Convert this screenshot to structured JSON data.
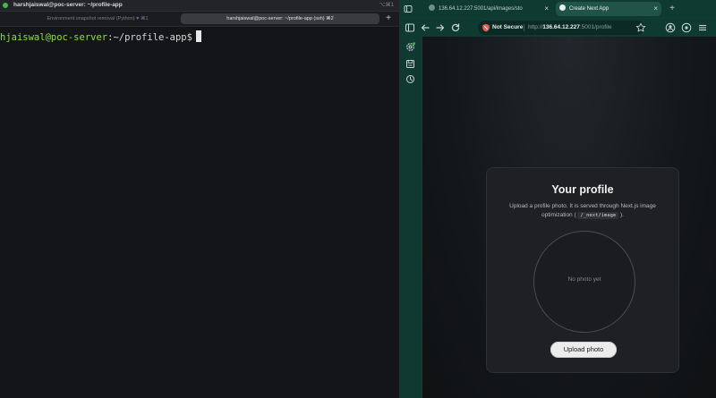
{
  "terminal": {
    "window_title": "harshjaiswal@poc-server: ~/profile-app",
    "shortcut": "⌥⌘1",
    "tabs": [
      {
        "label": "Environment snapshot removal (Python)",
        "count": "⌘1"
      },
      {
        "label": "harshjaiswal@poc-server: ~/profile-app (ssh)",
        "count": "⌘2"
      }
    ],
    "new_tab_label": "+",
    "prompt": {
      "user_host": "hjaiswal@poc-server",
      "separator": ":",
      "path": "~/profile-app",
      "symbol": "$"
    }
  },
  "browser": {
    "tabs": [
      {
        "label": "136.64.12.227:5001/api/images/sto",
        "active": false
      },
      {
        "label": "Create Next App",
        "active": true
      }
    ],
    "new_tab_label": "+",
    "urlbar": {
      "security_label": "Not Secure",
      "scheme": "http://",
      "host": "136.64.12.227",
      "rest": ":5001/profile"
    },
    "page": {
      "title": "Your profile",
      "description_before": "Upload a profile photo. It is served through Next.js image optimization (",
      "code": "/_next/image",
      "description_after": ").",
      "empty_photo_text": "No photo yet",
      "upload_button": "Upload photo"
    }
  },
  "colors": {
    "prompt_user": "#8ae234",
    "terminal_bg": "#141518",
    "browser_chrome": "#0f3a31",
    "accent_green": "#3fb950"
  },
  "icons": {
    "terminal": [
      "status-dot"
    ],
    "browser_toolbar": [
      "sidebar-toggle-icon",
      "back-icon",
      "forward-icon",
      "reload-icon",
      "not-secure-icon",
      "star-icon",
      "profile-icon",
      "extensions-icon",
      "menu-icon"
    ],
    "browser_sidebar": [
      "settings-icon",
      "save-icon",
      "history-icon"
    ]
  }
}
